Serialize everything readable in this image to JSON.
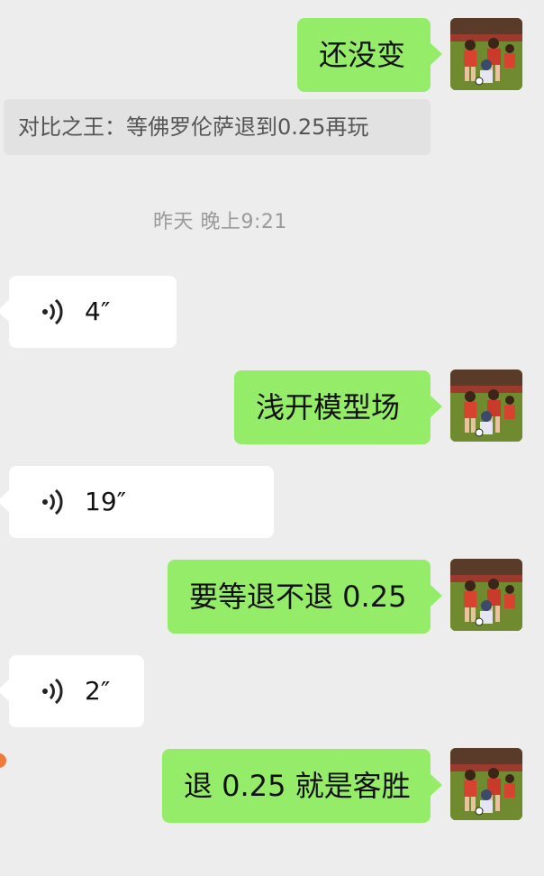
{
  "messages": [
    {
      "type": "outgoing",
      "text": "还没变"
    },
    {
      "type": "quote",
      "text": "对比之王：等佛罗伦萨退到0.25再玩"
    },
    {
      "type": "timestamp",
      "text": "昨天 晚上9:21"
    },
    {
      "type": "voice",
      "duration": "4″"
    },
    {
      "type": "outgoing",
      "text": "浅开模型场"
    },
    {
      "type": "voice",
      "duration": "19″"
    },
    {
      "type": "outgoing",
      "text": "要等退不退 0.25"
    },
    {
      "type": "voice",
      "duration": "2″"
    },
    {
      "type": "outgoing",
      "text": "退 0.25 就是客胜"
    }
  ],
  "colors": {
    "background": "#ededed",
    "outgoing_bubble": "#95ec69",
    "incoming_bubble": "#ffffff",
    "quote_bg": "#e2e2e2",
    "timestamp": "#9a9a9a"
  },
  "icons": {
    "voice": "voice-wave-icon",
    "avatar": "football-players-avatar"
  }
}
